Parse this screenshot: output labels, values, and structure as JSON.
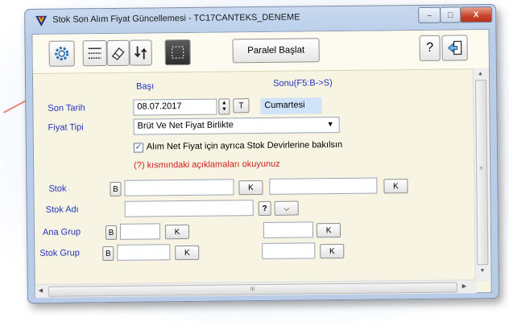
{
  "window": {
    "title": "Stok Son Alım Fiyat Güncellemesi - TC17CANTEKS_DENEME",
    "minimize_glyph": "–",
    "maximize_glyph": "□",
    "close_glyph": "X"
  },
  "toolbar": {
    "parallel_start_label": "Paralel Başlat",
    "help_label": "?"
  },
  "form": {
    "start_header": "Başı",
    "end_header": "Sonu(F5:B->S)",
    "last_date_label": "Son Tarih",
    "last_date_value": "08.07.2017",
    "today_button_label": "T",
    "day_name": "Cumartesi",
    "price_type_label": "Fiyat Tipi",
    "price_type_value": "Brüt Ve Net Fiyat Birlikte",
    "checkbox_label": "Alım Net Fiyat için ayrıca Stok Devirlerine bakılsın",
    "checkbox_checked": true,
    "notice_text": "(?) kısmındaki açıklamaları okuyunuz",
    "stock_label": "Stok",
    "stock_name_label": "Stok Adı",
    "main_group_label": "Ana Grup",
    "stock_group_label": "Stok Grup",
    "b_label": "B",
    "k_label": "K",
    "question_label": "?"
  },
  "scroll": {
    "h_thumb_glyph": "III"
  }
}
